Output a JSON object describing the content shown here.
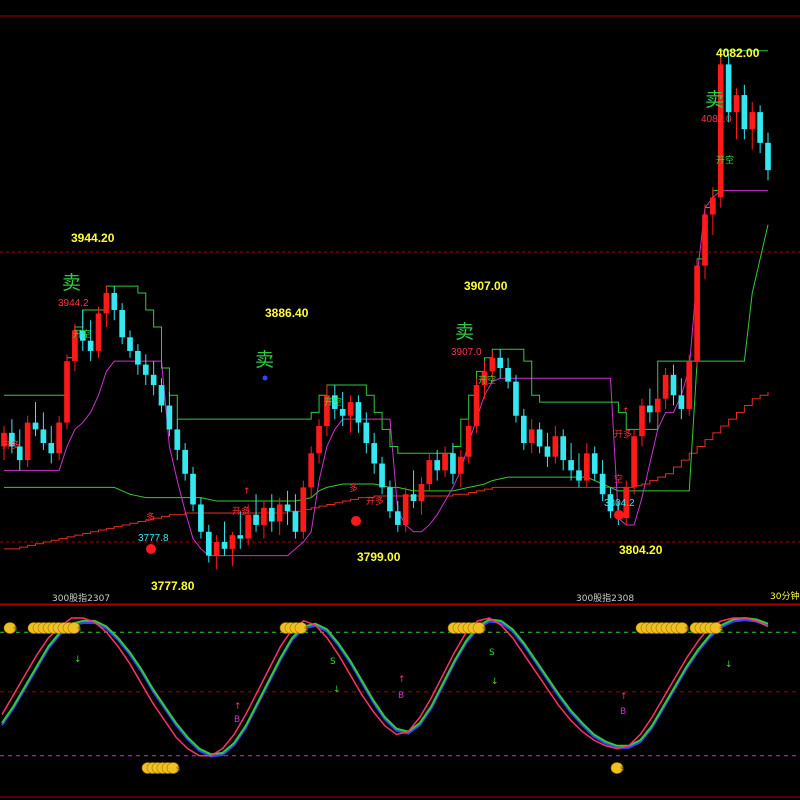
{
  "colors": {
    "up": "#ff1a1a",
    "down": "#33e8f0",
    "upper_band": "#2ecc40",
    "lower_band": "#cc33cc",
    "mid_band": "#33cc33",
    "baseline": "#e03020",
    "ref_line": "#aa0000",
    "sell": "#2ecc40",
    "signal_open_long": "#ff3333",
    "signal_open_short": "#33dd33",
    "oscillator_fast": "#ff3366",
    "oscillator_slow": "#33cc33",
    "oscillator_shadow": "#3344ff",
    "osc_upper_level": "#33cc33",
    "osc_lower_level": "#cc33cc",
    "low_dot": "#ff1a1a",
    "blue_marker": "#3344ff"
  },
  "price_labels": {
    "high_4082": "4082.00",
    "high_3944": "3944.20",
    "high_3886": "3886.40",
    "high_3907": "3907.00",
    "low_3777": "3777.80",
    "low_3799": "3799.00",
    "low_3804": "3804.20"
  },
  "mark_labels": {
    "m_3944": "3944.2",
    "m_3907": "3907.0",
    "m_4082": "4082.0",
    "m_3777": "3777.8",
    "m_3804": "3804.2"
  },
  "sell_label": "卖",
  "signals": {
    "open_long": "开多",
    "open_short": "开空",
    "box": "多",
    "box2": "空",
    "buy_b": "B",
    "sell_s": "S"
  },
  "period_labels": {
    "p1": "300股指2307",
    "p2": "300股指2308",
    "timeframe": "30分钟"
  },
  "coin_glyph": "$",
  "chart_data": {
    "type": "candlestick",
    "candles": [
      [
        3850,
        3862,
        3842,
        3858
      ],
      [
        3858,
        3866,
        3846,
        3850
      ],
      [
        3850,
        3860,
        3836,
        3842
      ],
      [
        3842,
        3868,
        3838,
        3864
      ],
      [
        3864,
        3876,
        3856,
        3860
      ],
      [
        3860,
        3870,
        3848,
        3852
      ],
      [
        3852,
        3862,
        3840,
        3846
      ],
      [
        3846,
        3868,
        3842,
        3864
      ],
      [
        3864,
        3904,
        3860,
        3900
      ],
      [
        3900,
        3922,
        3894,
        3918
      ],
      [
        3918,
        3930,
        3906,
        3912
      ],
      [
        3912,
        3924,
        3900,
        3906
      ],
      [
        3906,
        3932,
        3902,
        3928
      ],
      [
        3928,
        3944,
        3920,
        3940
      ],
      [
        3940,
        3944,
        3924,
        3930
      ],
      [
        3930,
        3934,
        3910,
        3914
      ],
      [
        3914,
        3918,
        3902,
        3906
      ],
      [
        3906,
        3910,
        3892,
        3898
      ],
      [
        3898,
        3904,
        3886,
        3892
      ],
      [
        3892,
        3900,
        3880,
        3886
      ],
      [
        3886,
        3890,
        3870,
        3874
      ],
      [
        3874,
        3882,
        3856,
        3860
      ],
      [
        3860,
        3866,
        3842,
        3848
      ],
      [
        3848,
        3852,
        3830,
        3834
      ],
      [
        3834,
        3838,
        3812,
        3816
      ],
      [
        3816,
        3820,
        3796,
        3800
      ],
      [
        3800,
        3804,
        3782,
        3786
      ],
      [
        3786,
        3798,
        3778,
        3794
      ],
      [
        3794,
        3806,
        3786,
        3790
      ],
      [
        3790,
        3800,
        3780,
        3798
      ],
      [
        3798,
        3812,
        3790,
        3796
      ],
      [
        3796,
        3816,
        3792,
        3810
      ],
      [
        3810,
        3822,
        3800,
        3804
      ],
      [
        3804,
        3818,
        3796,
        3814
      ],
      [
        3814,
        3822,
        3800,
        3806
      ],
      [
        3806,
        3820,
        3798,
        3816
      ],
      [
        3816,
        3824,
        3804,
        3812
      ],
      [
        3812,
        3822,
        3796,
        3800
      ],
      [
        3800,
        3830,
        3796,
        3826
      ],
      [
        3826,
        3850,
        3820,
        3846
      ],
      [
        3846,
        3866,
        3840,
        3862
      ],
      [
        3862,
        3886,
        3856,
        3880
      ],
      [
        3880,
        3886,
        3866,
        3872
      ],
      [
        3872,
        3882,
        3862,
        3868
      ],
      [
        3868,
        3880,
        3858,
        3876
      ],
      [
        3876,
        3880,
        3858,
        3864
      ],
      [
        3864,
        3870,
        3846,
        3852
      ],
      [
        3852,
        3858,
        3834,
        3840
      ],
      [
        3840,
        3844,
        3822,
        3826
      ],
      [
        3826,
        3830,
        3808,
        3812
      ],
      [
        3812,
        3818,
        3800,
        3804
      ],
      [
        3804,
        3826,
        3800,
        3822
      ],
      [
        3822,
        3836,
        3814,
        3818
      ],
      [
        3818,
        3832,
        3810,
        3828
      ],
      [
        3828,
        3846,
        3824,
        3842
      ],
      [
        3842,
        3848,
        3830,
        3836
      ],
      [
        3836,
        3850,
        3832,
        3846
      ],
      [
        3846,
        3852,
        3828,
        3834
      ],
      [
        3834,
        3848,
        3826,
        3844
      ],
      [
        3844,
        3866,
        3840,
        3862
      ],
      [
        3862,
        3890,
        3858,
        3886
      ],
      [
        3886,
        3900,
        3878,
        3894
      ],
      [
        3894,
        3906,
        3888,
        3902
      ],
      [
        3902,
        3907,
        3890,
        3896
      ],
      [
        3896,
        3902,
        3884,
        3888
      ],
      [
        3888,
        3892,
        3864,
        3868
      ],
      [
        3868,
        3872,
        3848,
        3852
      ],
      [
        3852,
        3866,
        3846,
        3860
      ],
      [
        3860,
        3864,
        3846,
        3850
      ],
      [
        3850,
        3858,
        3838,
        3844
      ],
      [
        3844,
        3862,
        3840,
        3856
      ],
      [
        3856,
        3860,
        3836,
        3842
      ],
      [
        3842,
        3852,
        3830,
        3836
      ],
      [
        3836,
        3846,
        3826,
        3830
      ],
      [
        3830,
        3852,
        3826,
        3846
      ],
      [
        3846,
        3850,
        3830,
        3834
      ],
      [
        3834,
        3842,
        3818,
        3822
      ],
      [
        3822,
        3826,
        3808,
        3812
      ],
      [
        3812,
        3818,
        3804,
        3808
      ],
      [
        3808,
        3830,
        3804,
        3826
      ],
      [
        3826,
        3860,
        3822,
        3856
      ],
      [
        3856,
        3878,
        3850,
        3874
      ],
      [
        3874,
        3884,
        3864,
        3870
      ],
      [
        3870,
        3882,
        3862,
        3878
      ],
      [
        3878,
        3896,
        3872,
        3892
      ],
      [
        3892,
        3898,
        3874,
        3880
      ],
      [
        3880,
        3890,
        3866,
        3872
      ],
      [
        3872,
        3904,
        3868,
        3900
      ],
      [
        3900,
        3960,
        3896,
        3956
      ],
      [
        3956,
        3992,
        3948,
        3986
      ],
      [
        3986,
        4002,
        3974,
        3996
      ],
      [
        3996,
        4082,
        3990,
        4074
      ],
      [
        4074,
        4080,
        4040,
        4046
      ],
      [
        4046,
        4060,
        4030,
        4056
      ],
      [
        4056,
        4062,
        4030,
        4036
      ],
      [
        4036,
        4052,
        4024,
        4046
      ],
      [
        4046,
        4050,
        4022,
        4028
      ],
      [
        4028,
        4034,
        4006,
        4012
      ]
    ],
    "upper_band": [
      3880,
      3880,
      3880,
      3880,
      3880,
      3880,
      3880,
      3880,
      3902,
      3920,
      3930,
      3930,
      3930,
      3944,
      3944,
      3944,
      3944,
      3940,
      3930,
      3920,
      3896,
      3880,
      3866,
      3866,
      3866,
      3866,
      3866,
      3866,
      3866,
      3866,
      3866,
      3866,
      3866,
      3866,
      3866,
      3866,
      3866,
      3866,
      3866,
      3870,
      3880,
      3886,
      3886,
      3886,
      3886,
      3886,
      3880,
      3870,
      3860,
      3850,
      3846,
      3846,
      3846,
      3846,
      3846,
      3846,
      3846,
      3850,
      3866,
      3880,
      3894,
      3902,
      3907,
      3907,
      3907,
      3907,
      3900,
      3880,
      3876,
      3876,
      3876,
      3876,
      3876,
      3876,
      3876,
      3876,
      3876,
      3876,
      3870,
      3860,
      3860,
      3860,
      3860,
      3900,
      3900,
      3900,
      3900,
      3900,
      3960,
      3990,
      4000,
      4082,
      4082,
      4082,
      4082,
      4082,
      4082,
      4082
    ],
    "lower_band": [
      3836,
      3836,
      3836,
      3836,
      3836,
      3836,
      3836,
      3836,
      3850,
      3860,
      3864,
      3870,
      3880,
      3894,
      3900,
      3900,
      3900,
      3900,
      3900,
      3900,
      3900,
      3850,
      3830,
      3812,
      3796,
      3790,
      3786,
      3786,
      3786,
      3786,
      3786,
      3786,
      3786,
      3786,
      3786,
      3786,
      3786,
      3790,
      3794,
      3800,
      3830,
      3850,
      3860,
      3866,
      3866,
      3866,
      3866,
      3866,
      3866,
      3866,
      3812,
      3804,
      3800,
      3800,
      3804,
      3810,
      3818,
      3826,
      3836,
      3852,
      3866,
      3880,
      3888,
      3890,
      3890,
      3890,
      3890,
      3890,
      3890,
      3890,
      3890,
      3890,
      3890,
      3890,
      3890,
      3890,
      3890,
      3890,
      3808,
      3804,
      3804,
      3820,
      3840,
      3860,
      3870,
      3870,
      3880,
      3896,
      3950,
      3990,
      3996,
      4000,
      4000,
      4000,
      4000,
      4000,
      4000,
      4000
    ],
    "mid_band": [
      3826,
      3826,
      3826,
      3826,
      3826,
      3826,
      3826,
      3826,
      3826,
      3826,
      3826,
      3826,
      3826,
      3826,
      3826,
      3824,
      3822,
      3821,
      3820,
      3820,
      3820,
      3820,
      3820,
      3820,
      3820,
      3820,
      3819,
      3818,
      3818,
      3818,
      3818,
      3818,
      3818,
      3818,
      3818,
      3818,
      3818,
      3818,
      3819,
      3820,
      3824,
      3826,
      3827,
      3828,
      3828,
      3828,
      3828,
      3828,
      3827,
      3826,
      3826,
      3825,
      3824,
      3824,
      3824,
      3824,
      3824,
      3824,
      3825,
      3826,
      3827,
      3828,
      3830,
      3831,
      3832,
      3832,
      3832,
      3832,
      3832,
      3832,
      3832,
      3832,
      3832,
      3832,
      3832,
      3830,
      3828,
      3826,
      3824,
      3824,
      3824,
      3824,
      3824,
      3824,
      3824,
      3824,
      3824,
      3824,
      3900,
      3900,
      3900,
      3900,
      3900,
      3900,
      3900,
      3940,
      3960,
      3980
    ],
    "baseline": [
      3790,
      3790,
      3791,
      3792,
      3793,
      3794,
      3795,
      3796,
      3797,
      3798,
      3799,
      3800,
      3801,
      3802,
      3803,
      3804,
      3805,
      3806,
      3807,
      3808,
      3809,
      3810,
      3810,
      3811,
      3811,
      3811,
      3811,
      3811,
      3811,
      3811,
      3811,
      3811,
      3811,
      3811,
      3811,
      3811,
      3812,
      3812,
      3813,
      3814,
      3815,
      3816,
      3817,
      3818,
      3819,
      3820,
      3820,
      3821,
      3821,
      3821,
      3821,
      3821,
      3821,
      3821,
      3821,
      3821,
      3821,
      3822,
      3822,
      3823,
      3824,
      3825,
      3826,
      3826,
      3826,
      3826,
      3826,
      3826,
      3826,
      3826,
      3826,
      3826,
      3826,
      3826,
      3826,
      3826,
      3826,
      3826,
      3826,
      3826,
      3827,
      3828,
      3830,
      3832,
      3834,
      3838,
      3842,
      3846,
      3850,
      3854,
      3858,
      3862,
      3866,
      3870,
      3874,
      3878,
      3880,
      3882
    ],
    "ref_lines": [
      3964,
      3794
    ],
    "price_range": [
      3760,
      4100
    ],
    "oscillator": {
      "fast": [
        32,
        46,
        60,
        74,
        86,
        94,
        100,
        100,
        97,
        90,
        80,
        68,
        54,
        40,
        28,
        16,
        8,
        3,
        3,
        8,
        18,
        32,
        48,
        64,
        80,
        92,
        98,
        95,
        86,
        74,
        60,
        46,
        34,
        24,
        18,
        20,
        30,
        44,
        60,
        76,
        90,
        98,
        100,
        95,
        86,
        74,
        62,
        50,
        38,
        28,
        20,
        14,
        10,
        8,
        10,
        18,
        30,
        44,
        58,
        72,
        84,
        94,
        98,
        100,
        100,
        98,
        94
      ],
      "slow": [
        26,
        38,
        52,
        66,
        80,
        90,
        96,
        98,
        98,
        94,
        86,
        76,
        64,
        50,
        38,
        26,
        16,
        8,
        4,
        5,
        12,
        24,
        40,
        56,
        72,
        86,
        94,
        96,
        92,
        82,
        70,
        56,
        42,
        30,
        22,
        20,
        26,
        38,
        54,
        70,
        84,
        94,
        99,
        98,
        92,
        82,
        70,
        58,
        46,
        35,
        26,
        18,
        13,
        10,
        10,
        14,
        24,
        38,
        52,
        66,
        78,
        88,
        95,
        99,
        100,
        99,
        96
      ],
      "upper_level": 90,
      "lower_level": 3,
      "mid_level": 48
    }
  }
}
